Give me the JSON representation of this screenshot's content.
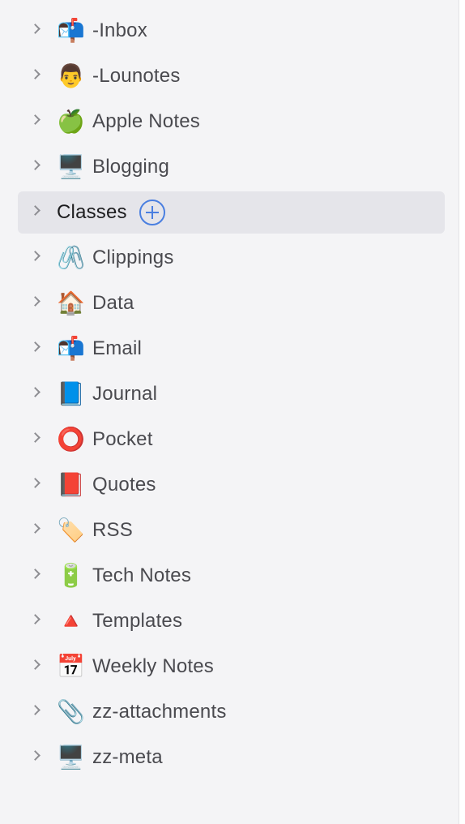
{
  "sidebar": {
    "items": [
      {
        "label": "-Inbox",
        "icon": "📬",
        "icon_name": "mailbox-icon"
      },
      {
        "label": "-Lounotes",
        "icon": "👨",
        "icon_name": "man-icon"
      },
      {
        "label": "Apple Notes",
        "icon": "🍏",
        "icon_name": "apple-icon"
      },
      {
        "label": "Blogging",
        "icon": "🖥️",
        "icon_name": "desktop-computer-icon"
      },
      {
        "label": "Classes",
        "icon": "",
        "icon_name": "",
        "selected": true
      },
      {
        "label": "Clippings",
        "icon": "🖇️",
        "icon_name": "linked-paperclips-icon"
      },
      {
        "label": "Data",
        "icon": "🏠",
        "icon_name": "house-icon"
      },
      {
        "label": "Email",
        "icon": "📬",
        "icon_name": "mailbox-icon"
      },
      {
        "label": "Journal",
        "icon": "📘",
        "icon_name": "blue-book-icon"
      },
      {
        "label": "Pocket",
        "icon": "⭕",
        "icon_name": "red-circle-icon"
      },
      {
        "label": "Quotes",
        "icon": "📕",
        "icon_name": "red-book-icon"
      },
      {
        "label": "RSS",
        "icon": "🏷️",
        "icon_name": "label-tag-icon"
      },
      {
        "label": "Tech Notes",
        "icon": "🔋",
        "icon_name": "battery-icon"
      },
      {
        "label": "Templates",
        "icon": "🔺",
        "icon_name": "red-triangle-icon"
      },
      {
        "label": "Weekly Notes",
        "icon": "📅",
        "icon_name": "calendar-icon"
      },
      {
        "label": "zz-attachments",
        "icon": "📎",
        "icon_name": "paperclip-icon"
      },
      {
        "label": "zz-meta",
        "icon": "🖥️",
        "icon_name": "desktop-computer-icon"
      }
    ],
    "add_button_icon": "plus-circle-icon",
    "colors": {
      "background": "#f4f4f6",
      "selected_row": "#e5e5ea",
      "accent": "#4a7fe0",
      "chevron": "#8e8e93"
    }
  }
}
